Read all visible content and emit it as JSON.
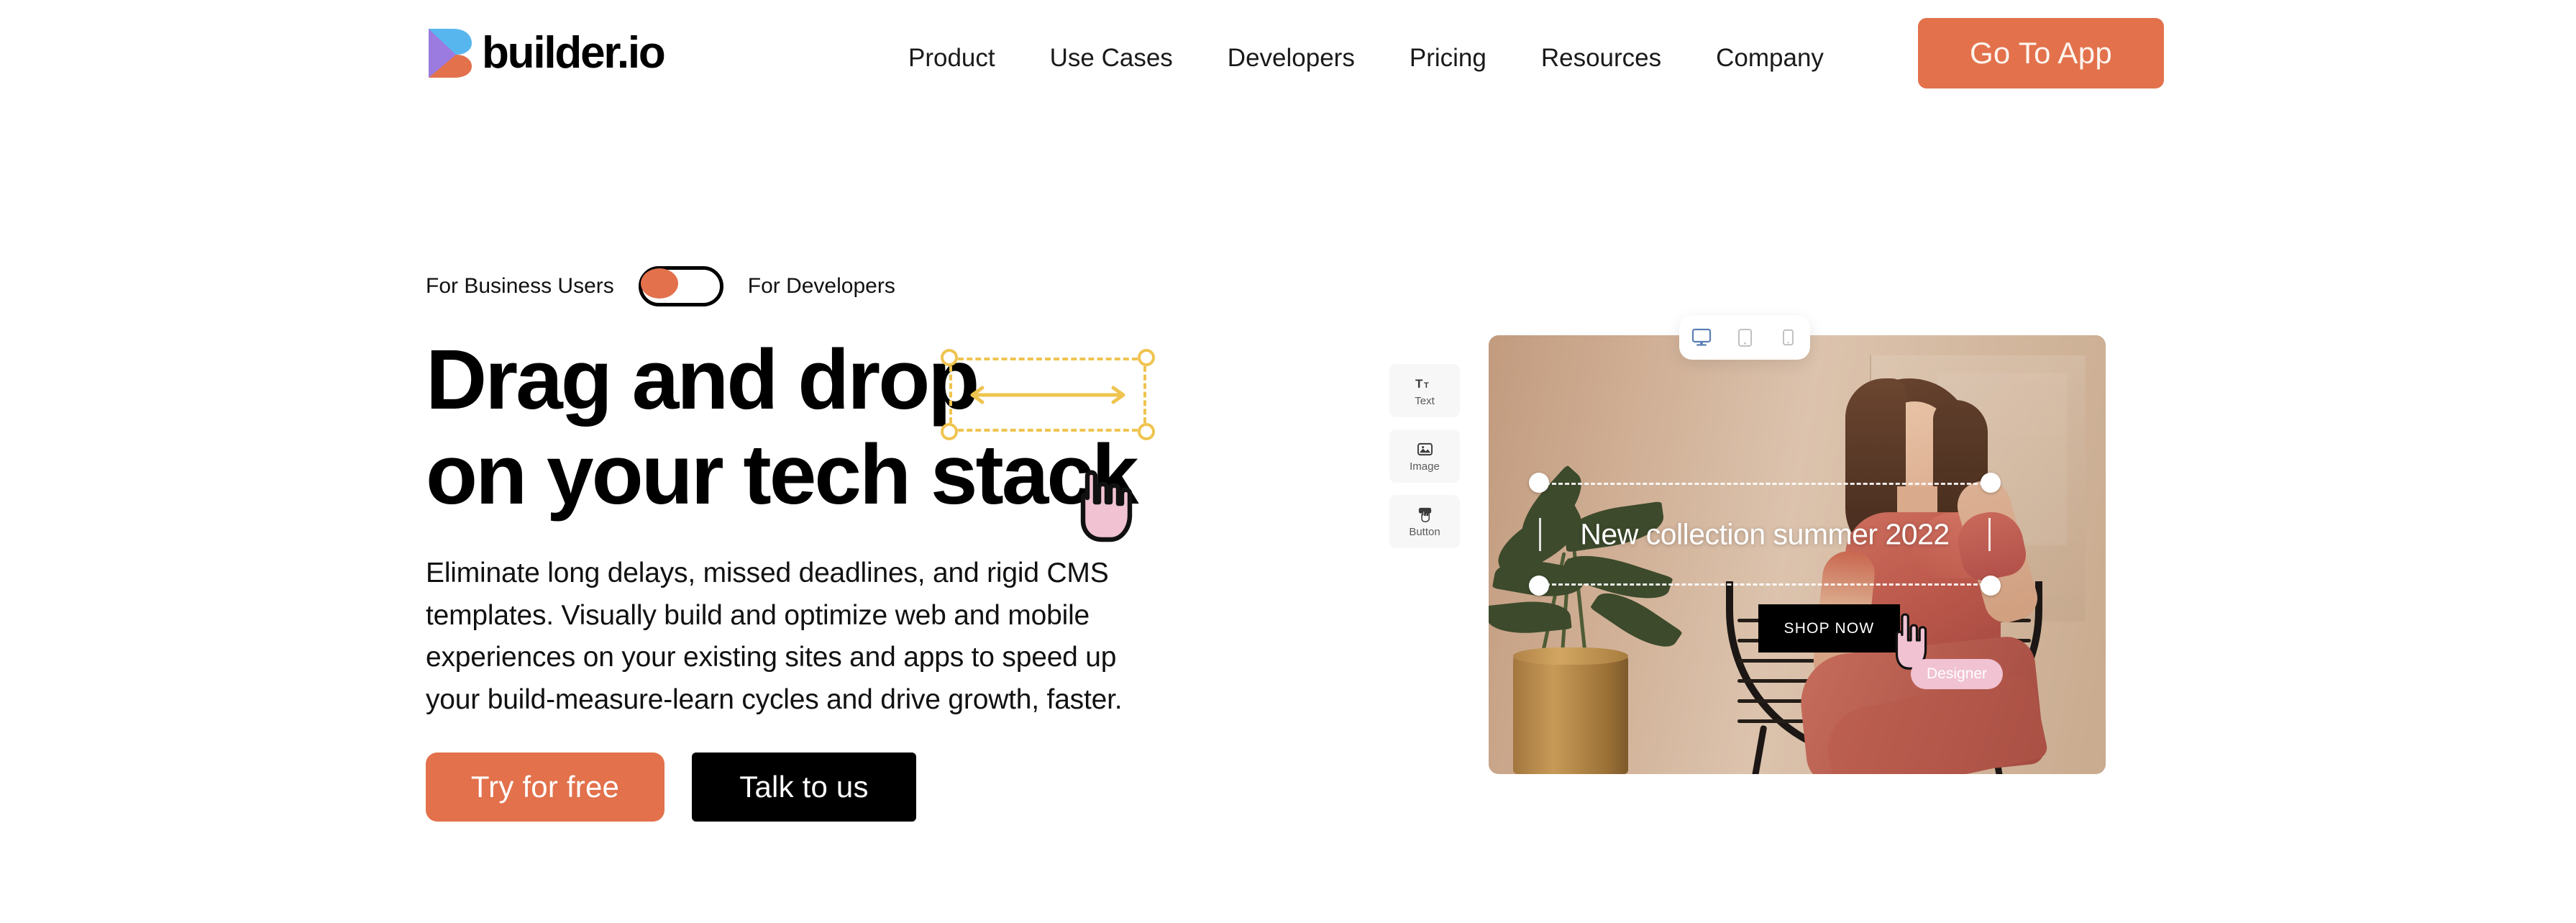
{
  "brand": {
    "name": "builder.io",
    "logo_icon": "builder-logo-icon",
    "accent_color": "#E2714C",
    "logo_blue": "#58B6EE",
    "logo_purple": "#9B7BE0",
    "logo_orange": "#E2714C"
  },
  "header": {
    "nav_items": [
      {
        "label": "Product"
      },
      {
        "label": "Use Cases"
      },
      {
        "label": "Developers"
      },
      {
        "label": "Pricing"
      },
      {
        "label": "Resources"
      },
      {
        "label": "Company"
      }
    ],
    "cta_label": "Go To App"
  },
  "hero": {
    "toggle": {
      "left_label": "For Business Users",
      "right_label": "For Developers",
      "state": "left",
      "knob_color": "#E2714C"
    },
    "headline_line1": "Drag and drop",
    "headline_line2": "on your tech stack",
    "decor": {
      "selection_box_color": "#EFC44F",
      "selection_icon": "resize-handles-icon",
      "arrow_icon": "double-arrow-horizontal-icon",
      "hand_icon": "pointing-hand-cursor-icon",
      "hand_color": "#F0C2D2"
    },
    "body": "Eliminate long delays, missed deadlines, and rigid CMS templates. Visually build and optimize web and mobile experiences on your existing sites and apps to speed up your build-measure-learn cycles and drive growth, faster.",
    "primary_cta": "Try for free",
    "secondary_cta": "Talk to us"
  },
  "editor_preview": {
    "palette": [
      {
        "label": "Text",
        "icon": "text-tt-icon"
      },
      {
        "label": "Image",
        "icon": "image-picture-icon"
      },
      {
        "label": "Button",
        "icon": "button-cursor-icon"
      }
    ],
    "devices": [
      {
        "name": "desktop",
        "icon": "desktop-monitor-icon",
        "selected": true
      },
      {
        "name": "tablet",
        "icon": "tablet-icon",
        "selected": false
      },
      {
        "name": "mobile",
        "icon": "mobile-phone-icon",
        "selected": false
      }
    ],
    "canvas": {
      "heading": "New collection summer 2022",
      "shop_button": "SHOP NOW",
      "cursor_icon": "pointing-hand-cursor-icon",
      "collaborator_badge": "Designer",
      "badge_color": "#F0C2D2",
      "selection_handle_icon": "resize-handle-icon"
    }
  }
}
